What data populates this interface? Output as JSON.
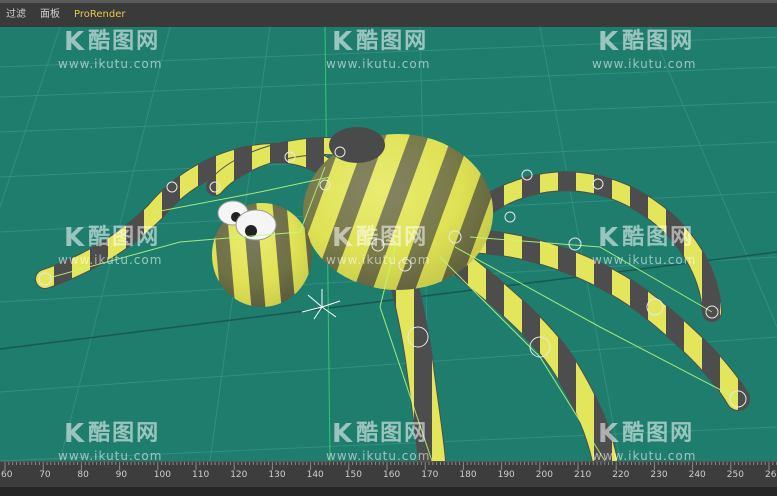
{
  "menu": {
    "items": [
      {
        "label": "过滤"
      },
      {
        "label": "面板"
      },
      {
        "label": "ProRender",
        "accent": true
      }
    ]
  },
  "watermark": {
    "logo_letter": "K",
    "logo_text": "酷图网",
    "url": "www.ikutu.com"
  },
  "viewport": {
    "background": "#1f7d6e",
    "grid_color": "#2f8f80",
    "object": "spider-rig",
    "stripe_colors": [
      "#e3e65a",
      "#4d4d4d"
    ]
  },
  "timeline": {
    "ticks": [
      "60",
      "70",
      "80",
      "90",
      "100",
      "110",
      "120",
      "130",
      "140",
      "150",
      "160",
      "170",
      "180",
      "190",
      "200",
      "210",
      "220",
      "230",
      "240",
      "250",
      "260"
    ],
    "current_frame": "170"
  }
}
